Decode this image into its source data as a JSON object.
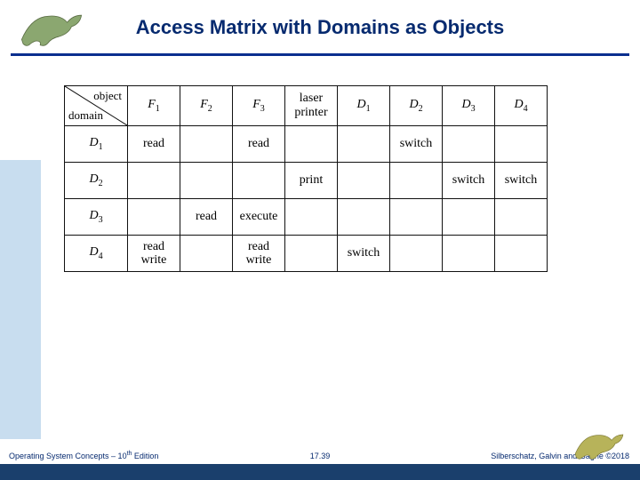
{
  "title": "Access Matrix with Domains as Objects",
  "corner": {
    "object": "object",
    "domain": "domain"
  },
  "columns": [
    "F",
    "F",
    "F",
    "laser\nprinter",
    "D",
    "D",
    "D",
    "D"
  ],
  "column_subs": [
    "1",
    "2",
    "3",
    "",
    "1",
    "2",
    "3",
    "4"
  ],
  "rows": [
    {
      "label": "D",
      "sub": "1",
      "cells": [
        "read",
        "",
        "read",
        "",
        "",
        "switch",
        "",
        ""
      ]
    },
    {
      "label": "D",
      "sub": "2",
      "cells": [
        "",
        "",
        "",
        "print",
        "",
        "",
        "switch",
        "switch"
      ]
    },
    {
      "label": "D",
      "sub": "3",
      "cells": [
        "",
        "read",
        "execute",
        "",
        "",
        "",
        "",
        ""
      ]
    },
    {
      "label": "D",
      "sub": "4",
      "cells": [
        "read\nwrite",
        "",
        "read\nwrite",
        "",
        "switch",
        "",
        "",
        ""
      ]
    }
  ],
  "footer": {
    "left_a": "Operating System Concepts – 10",
    "left_sup": "th",
    "left_b": " Edition",
    "center": "17.39",
    "right": "Silberschatz, Galvin and Gagne ©2018"
  }
}
